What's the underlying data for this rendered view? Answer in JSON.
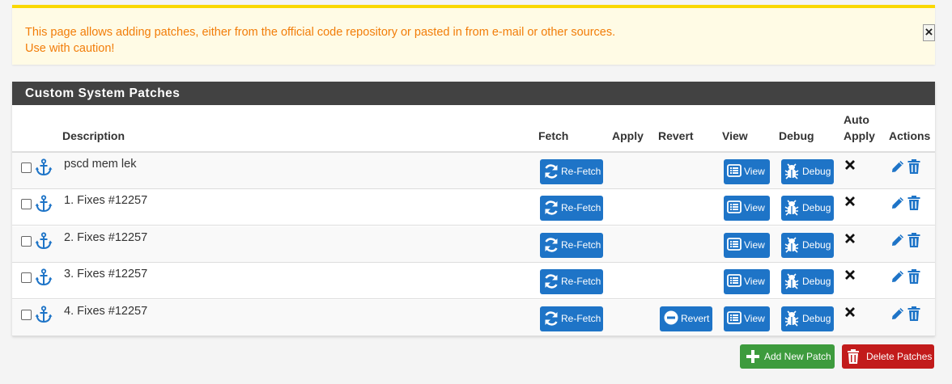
{
  "alert": {
    "line1": "This page allows adding patches, either from the official code repository or pasted in from e-mail or other sources.",
    "line2": "Use with caution!",
    "close_label": "×"
  },
  "panel": {
    "title": "Custom System Patches",
    "columns": {
      "description": "Description",
      "fetch": "Fetch",
      "apply": "Apply",
      "revert": "Revert",
      "view": "View",
      "debug": "Debug",
      "auto_apply_1": "Auto",
      "auto_apply_2": "Apply",
      "actions": "Actions"
    },
    "rows": [
      {
        "description": "pscd mem lek",
        "fetch": "Re-Fetch",
        "revert": "",
        "view": "View",
        "debug": "Debug"
      },
      {
        "description": "1. Fixes #12257",
        "fetch": "Re-Fetch",
        "revert": "",
        "view": "View",
        "debug": "Debug"
      },
      {
        "description": "2. Fixes #12257",
        "fetch": "Re-Fetch",
        "revert": "",
        "view": "View",
        "debug": "Debug"
      },
      {
        "description": "3. Fixes #12257",
        "fetch": "Re-Fetch",
        "revert": "",
        "view": "View",
        "debug": "Debug"
      },
      {
        "description": "4. Fixes #12257",
        "fetch": "Re-Fetch",
        "revert": "Revert",
        "view": "View",
        "debug": "Debug"
      }
    ]
  },
  "footer": {
    "add_label": "Add New Patch",
    "delete_label": "Delete Patches"
  },
  "colors": {
    "accent_blue": "#1e74c7",
    "success_green": "#3d9b3d",
    "danger_red": "#c21b1b",
    "warning_text": "#f27d09",
    "warning_bar": "#fad800",
    "header_dark": "#424242"
  },
  "icons": {
    "anchor": "anchor-icon",
    "refresh": "refresh-icon",
    "view": "list-icon",
    "debug": "bug-icon",
    "revert": "minus-circle-icon",
    "auto_apply_off": "x-icon",
    "edit": "pencil-icon",
    "delete": "trash-icon",
    "add": "plus-icon"
  }
}
